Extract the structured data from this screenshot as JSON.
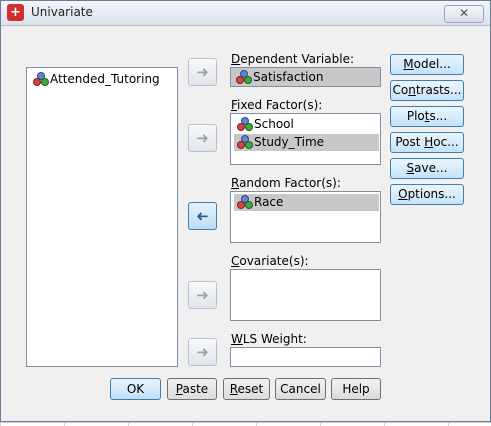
{
  "window": {
    "title": "Univariate",
    "app_icon_glyph": "+",
    "close_glyph": "✕",
    "icon": "univariate-app-icon"
  },
  "source_list": {
    "items": [
      {
        "label": "Attended_Tutoring",
        "icon": "variable-nominal-icon"
      }
    ]
  },
  "dependent_variable": {
    "label_prefix": "D",
    "label_rest": "ependent Variable:",
    "value": "Satisfaction"
  },
  "fixed_factors": {
    "label_prefix": "F",
    "label_rest": "ixed Factor(s):",
    "items": [
      "School",
      "Study_Time"
    ]
  },
  "random_factors": {
    "label_prefix": "R",
    "label_rest": "andom Factor(s):",
    "items": [
      "Race"
    ]
  },
  "covariates": {
    "label_prefix": "C",
    "label_rest": "ovariate(s):",
    "items": []
  },
  "wls_weight": {
    "label_prefix": "W",
    "label_rest": "LS Weight:",
    "value": ""
  },
  "arrow_glyphs": {
    "right": "➜",
    "left": "➜"
  },
  "side_buttons": [
    {
      "label_prefix": "M",
      "label_rest": "odel..."
    },
    {
      "label_prefix": "Co",
      "label_mid": "n",
      "label_rest": "trasts..."
    },
    {
      "label_prefix": "Plo",
      "label_mid": "t",
      "label_rest": "s..."
    },
    {
      "label_prefix": "Post ",
      "label_mid": "H",
      "label_rest": "oc..."
    },
    {
      "label_prefix": "",
      "label_mid": "S",
      "label_rest": "ave..."
    },
    {
      "label_prefix": "",
      "label_mid": "O",
      "label_rest": "ptions..."
    }
  ],
  "bottom_buttons": {
    "ok": "OK",
    "paste_u": "P",
    "paste_rest": "aste",
    "reset_u": "R",
    "reset_rest": "eset",
    "cancel": "Cancel",
    "help": "Help"
  }
}
